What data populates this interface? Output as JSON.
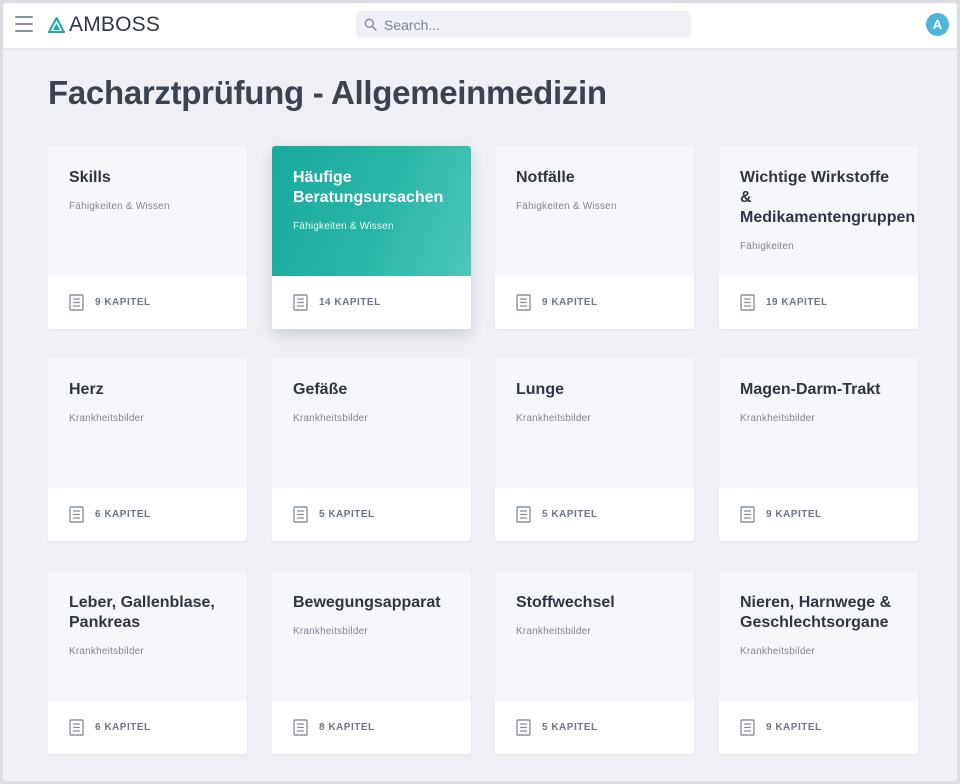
{
  "header": {
    "menu_icon": "hamburger-menu-icon",
    "logo_icon": "triangle-logo-icon",
    "logo_text": "AMBOSS",
    "search_placeholder": "Search...",
    "search_value": "",
    "avatar_letter": "A",
    "brand_color": "#1bab9c",
    "avatar_color": "#4fb4dc"
  },
  "page": {
    "title": "Facharztprüfung - Allgemeinmedizin"
  },
  "cards": [
    {
      "title": "Skills",
      "subtitle": "Fähigkeiten & Wissen",
      "chapters": "9 KAPITEL",
      "active": false
    },
    {
      "title": "Häufige Beratungsursachen",
      "subtitle": "Fähigkeiten & Wissen",
      "chapters": "14 KAPITEL",
      "active": true
    },
    {
      "title": "Notfälle",
      "subtitle": "Fähigkeiten & Wissen",
      "chapters": "9 KAPITEL",
      "active": false
    },
    {
      "title": "Wichtige Wirkstoffe & Medikamentengruppen",
      "subtitle": "Fähigkeiten",
      "chapters": "19 KAPITEL",
      "active": false
    },
    {
      "title": "Herz",
      "subtitle": "Krankheitsbilder",
      "chapters": "6 KAPITEL",
      "active": false
    },
    {
      "title": "Gefäße",
      "subtitle": "Krankheitsbilder",
      "chapters": "5 KAPITEL",
      "active": false
    },
    {
      "title": "Lunge",
      "subtitle": "Krankheitsbilder",
      "chapters": "5 KAPITEL",
      "active": false
    },
    {
      "title": "Magen-Darm-Trakt",
      "subtitle": "Krankheitsbilder",
      "chapters": "9 KAPITEL",
      "active": false
    },
    {
      "title": "Leber, Gallenblase, Pankreas",
      "subtitle": "Krankheitsbilder",
      "chapters": "6 KAPITEL",
      "active": false
    },
    {
      "title": "Bewegungsapparat",
      "subtitle": "Krankheitsbilder",
      "chapters": "8 KAPITEL",
      "active": false
    },
    {
      "title": "Stoffwechsel",
      "subtitle": "Krankheitsbilder",
      "chapters": "5 KAPITEL",
      "active": false
    },
    {
      "title": "Nieren, Harnwege & Geschlechtsorgane",
      "subtitle": "Krankheitsbilder",
      "chapters": "9 KAPITEL",
      "active": false
    }
  ]
}
